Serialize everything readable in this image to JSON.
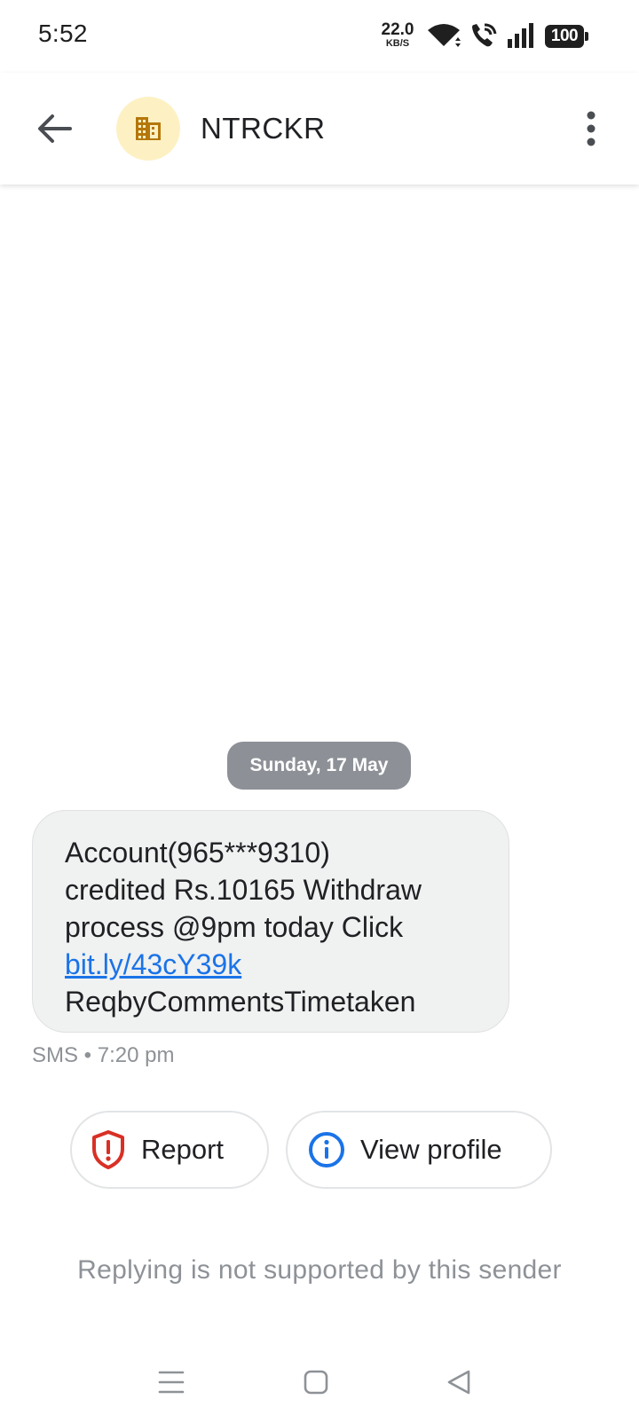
{
  "status_bar": {
    "time": "5:52",
    "net_speed": "22.0",
    "net_unit": "KB/S",
    "battery": "100",
    "icons": [
      "wifi-icon",
      "wifi-call-icon",
      "signal-icon",
      "battery-icon"
    ]
  },
  "app_bar": {
    "sender": "NTRCKR",
    "icons": [
      "arrow-back-icon",
      "business-icon",
      "more-vert-icon"
    ]
  },
  "conversation": {
    "date": "Sunday, 17 May",
    "message": {
      "line1": "Account(965***9310)",
      "line2": "credited Rs.10165 Withdraw",
      "line3": "process @9pm today Click",
      "link": "bit.ly/43cY39k",
      "line5": "ReqbyCommentsTimetaken"
    },
    "meta": "SMS • 7:20 pm"
  },
  "actions": {
    "report": "Report",
    "view_profile": "View profile",
    "icons": [
      "shield-alert-icon",
      "info-icon"
    ]
  },
  "reply_note": "Replying is not supported by this sender",
  "nav_bar": {
    "icons": [
      "menu-icon",
      "home-square-icon",
      "back-triangle-icon"
    ]
  },
  "colors": {
    "accent_link": "#1a73e8",
    "report_red": "#d93025",
    "avatar_bg": "#fdf1c4",
    "avatar_icon": "#b5770a",
    "date_chip_bg": "#8d9197",
    "bubble_bg": "#f0f1f1"
  }
}
